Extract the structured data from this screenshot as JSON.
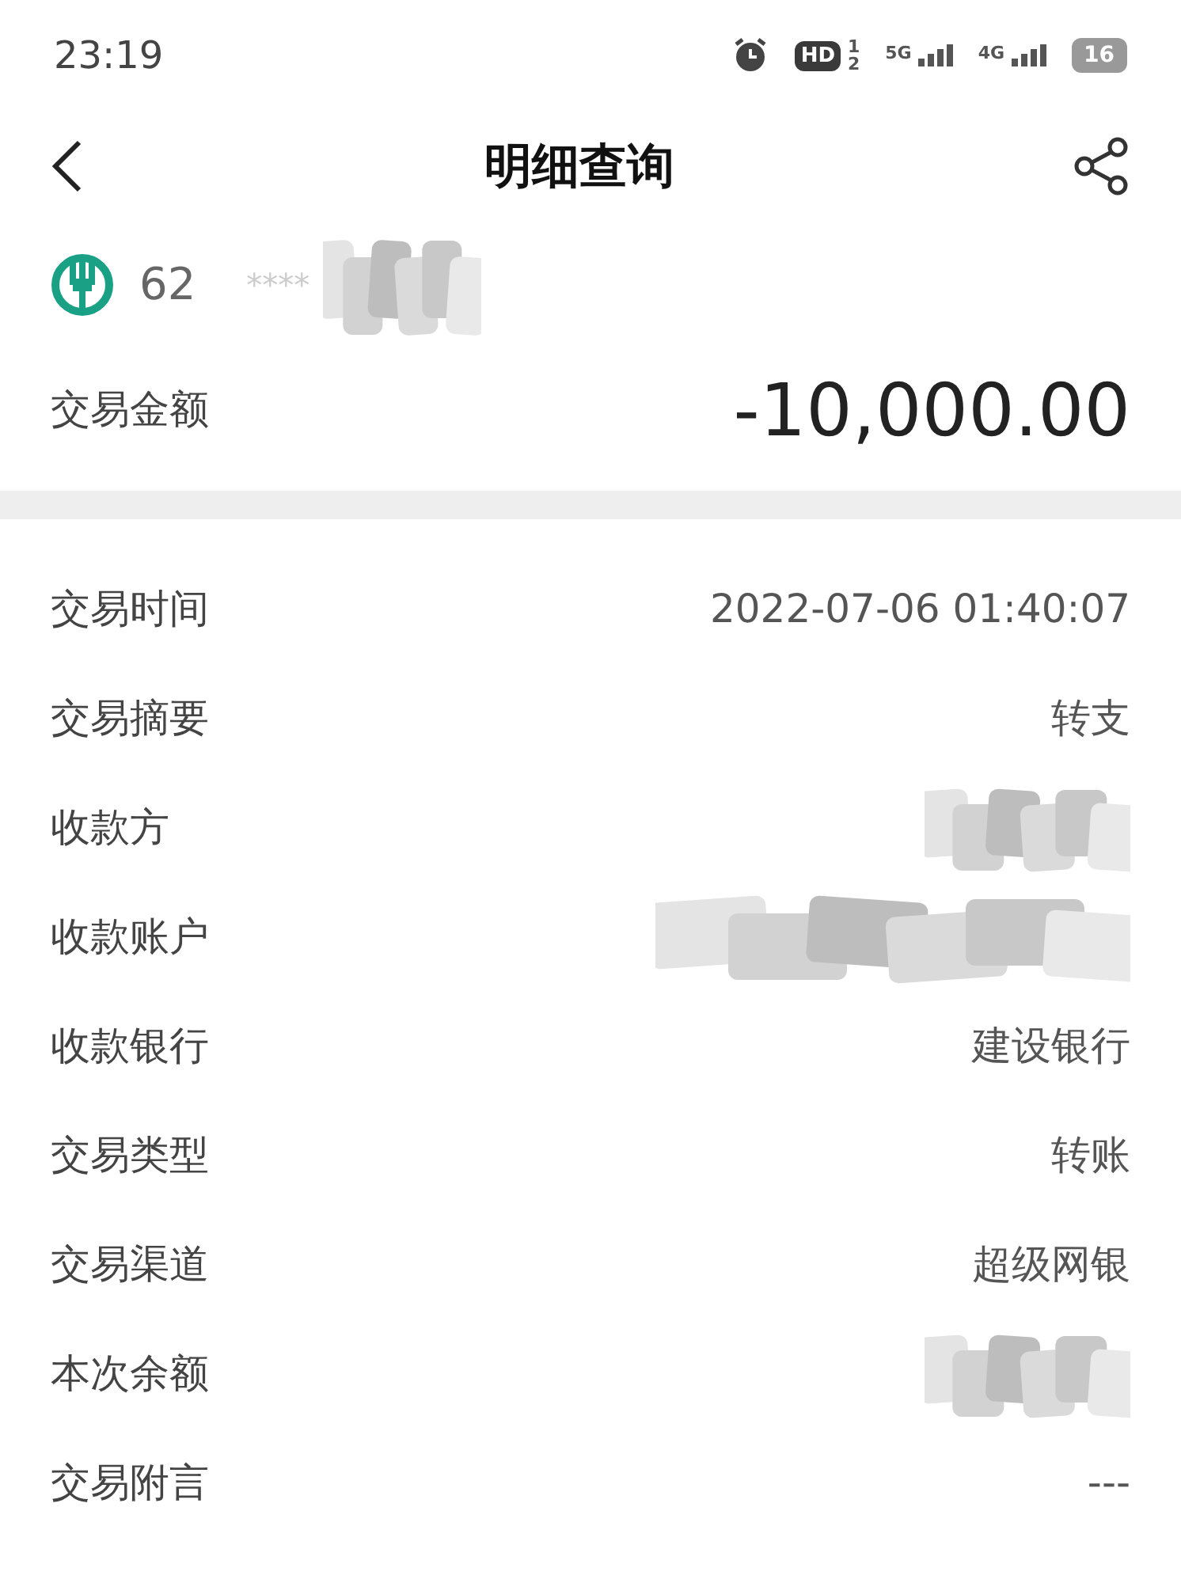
{
  "status_bar": {
    "time": "23:19",
    "hd": "HD",
    "hd_sims": [
      "1",
      "2"
    ],
    "networks": [
      "5G",
      "4G"
    ],
    "battery": "16"
  },
  "header": {
    "title": "明细查询"
  },
  "account": {
    "number_visible": "62",
    "mask": "****",
    "redacted": true
  },
  "amount": {
    "label": "交易金额",
    "value": "-10,000.00"
  },
  "details": [
    {
      "label": "交易时间",
      "kind": "text",
      "value": "2022-07-06 01:40:07"
    },
    {
      "label": "交易摘要",
      "kind": "text",
      "value": "转支"
    },
    {
      "label": "收款方",
      "kind": "redacted"
    },
    {
      "label": "收款账户",
      "kind": "redacted"
    },
    {
      "label": "收款银行",
      "kind": "text",
      "value": "建设银行"
    },
    {
      "label": "交易类型",
      "kind": "text",
      "value": "转账"
    },
    {
      "label": "交易渠道",
      "kind": "text",
      "value": "超级网银"
    },
    {
      "label": "本次余额",
      "kind": "redacted"
    },
    {
      "label": "交易附言",
      "kind": "text",
      "value": "---"
    }
  ]
}
